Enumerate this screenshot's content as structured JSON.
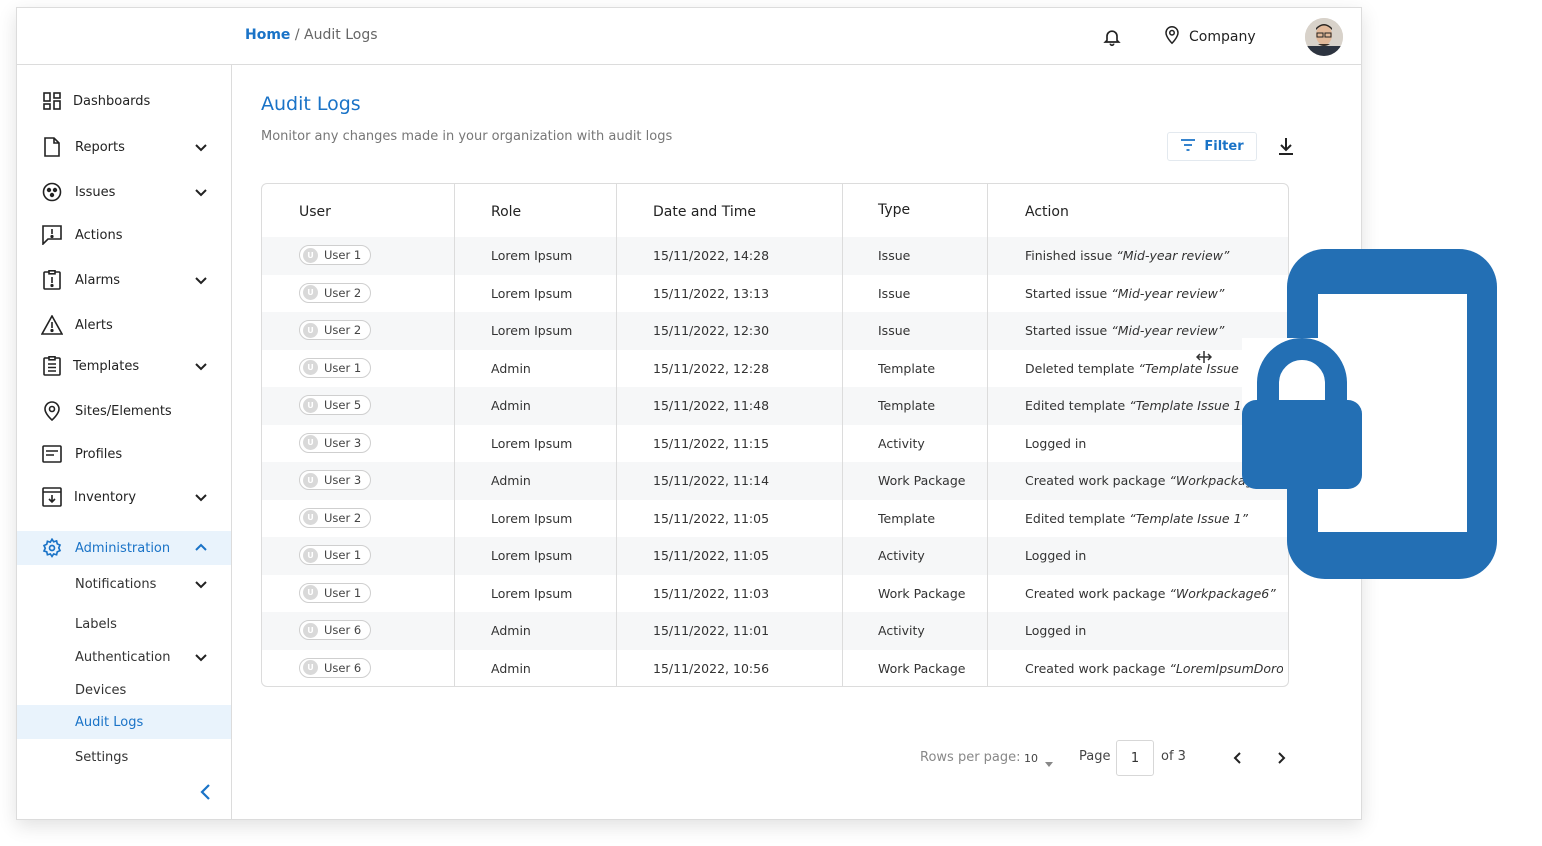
{
  "breadcrumb": {
    "home": "Home",
    "separator": "/",
    "current": "Audit Logs"
  },
  "header": {
    "company": "Company",
    "icons": [
      "bell-icon",
      "location-pin-icon",
      "avatar"
    ]
  },
  "sidebar": {
    "items": [
      {
        "label": "Dashboards",
        "icon": "dashboard-icon",
        "expandable": false
      },
      {
        "label": "Reports",
        "icon": "file-icon",
        "expandable": true
      },
      {
        "label": "Issues",
        "icon": "issues-icon",
        "expandable": true
      },
      {
        "label": "Actions",
        "icon": "chat-alert-icon",
        "expandable": false
      },
      {
        "label": "Alarms",
        "icon": "clipboard-alert-icon",
        "expandable": true
      },
      {
        "label": "Alerts",
        "icon": "warning-icon",
        "expandable": false
      },
      {
        "label": "Templates",
        "icon": "clipboard-list-icon",
        "expandable": true
      },
      {
        "label": "Sites/Elements",
        "icon": "location-pin-icon",
        "expandable": false
      },
      {
        "label": "Profiles",
        "icon": "profile-card-icon",
        "expandable": false
      },
      {
        "label": "Inventory",
        "icon": "inventory-icon",
        "expandable": true
      },
      {
        "label": "Administration",
        "icon": "gear-icon",
        "expandable": true,
        "active": true
      }
    ],
    "sub_items": [
      {
        "label": "Notifications",
        "expandable": true
      },
      {
        "label": "Labels",
        "expandable": false
      },
      {
        "label": "Authentication",
        "expandable": true
      },
      {
        "label": "Devices",
        "expandable": false
      },
      {
        "label": "Audit Logs",
        "expandable": false,
        "active": true
      },
      {
        "label": "Settings",
        "expandable": false
      }
    ]
  },
  "main": {
    "title": "Audit Logs",
    "subtitle": "Monitor any changes made in your organization with audit logs",
    "filter_label": "Filter"
  },
  "table": {
    "columns": [
      "User",
      "Role",
      "Date and Time",
      "Type",
      "Action"
    ],
    "rows": [
      {
        "initial": "U",
        "user": "User 1",
        "role": "Lorem Ipsum",
        "datetime": "15/11/2022,  14:28",
        "type": "Issue",
        "action_prefix": "Finished issue ",
        "action_italic": "“Mid-year review”"
      },
      {
        "initial": "U",
        "user": "User 2",
        "role": "Lorem Ipsum",
        "datetime": "15/11/2022,  13:13",
        "type": "Issue",
        "action_prefix": "Started issue ",
        "action_italic": "“Mid-year review”"
      },
      {
        "initial": "U",
        "user": "User 2",
        "role": "Lorem Ipsum",
        "datetime": "15/11/2022,  12:30",
        "type": "Issue",
        "action_prefix": "Started issue ",
        "action_italic": "“Mid-year review”"
      },
      {
        "initial": "U",
        "user": "User 1",
        "role": "Admin",
        "datetime": "15/11/2022,  12:28",
        "type": "Template",
        "action_prefix": "Deleted template ",
        "action_italic": "“Template Issue 1”"
      },
      {
        "initial": "U",
        "user": "User 5",
        "role": "Admin",
        "datetime": "15/11/2022,  11:48",
        "type": "Template",
        "action_prefix": "Edited template ",
        "action_italic": "“Template Issue 1”"
      },
      {
        "initial": "U",
        "user": "User 3",
        "role": "Lorem Ipsum",
        "datetime": "15/11/2022,  11:15",
        "type": "Activity",
        "action_prefix": "Logged in",
        "action_italic": ""
      },
      {
        "initial": "U",
        "user": "User 3",
        "role": "Admin",
        "datetime": "15/11/2022,  11:14",
        "type": "Work Package",
        "action_prefix": "Created work package ",
        "action_italic": "“Workpackage"
      },
      {
        "initial": "U",
        "user": "User 2",
        "role": "Lorem Ipsum",
        "datetime": "15/11/2022,  11:05",
        "type": "Template",
        "action_prefix": "Edited template ",
        "action_italic": "“Template Issue 1”"
      },
      {
        "initial": "U",
        "user": "User 1",
        "role": "Lorem Ipsum",
        "datetime": "15/11/2022,  11:05",
        "type": "Activity",
        "action_prefix": "Logged in",
        "action_italic": ""
      },
      {
        "initial": "U",
        "user": "User 1",
        "role": "Lorem Ipsum",
        "datetime": "15/11/2022,  11:03",
        "type": "Work Package",
        "action_prefix": "Created work package ",
        "action_italic": "“Workpackage6”"
      },
      {
        "initial": "U",
        "user": "User 6",
        "role": "Admin",
        "datetime": "15/11/2022,  11:01",
        "type": "Activity",
        "action_prefix": "Logged in",
        "action_italic": ""
      },
      {
        "initial": "U",
        "user": "User 6",
        "role": "Admin",
        "datetime": "15/11/2022,  10:56",
        "type": "Work Package",
        "action_prefix": "Created work package ",
        "action_italic": "“LoremIpsumDoro…"
      }
    ]
  },
  "pagination": {
    "rows_per_page_label": "Rows per page:",
    "rows_per_page_value": "10",
    "page_label": "Page",
    "current_page": "1",
    "of_label": "of 3"
  },
  "colors": {
    "accent": "#1a73c7",
    "lock": "#236fb4",
    "active_bg": "#e9f3fc"
  }
}
